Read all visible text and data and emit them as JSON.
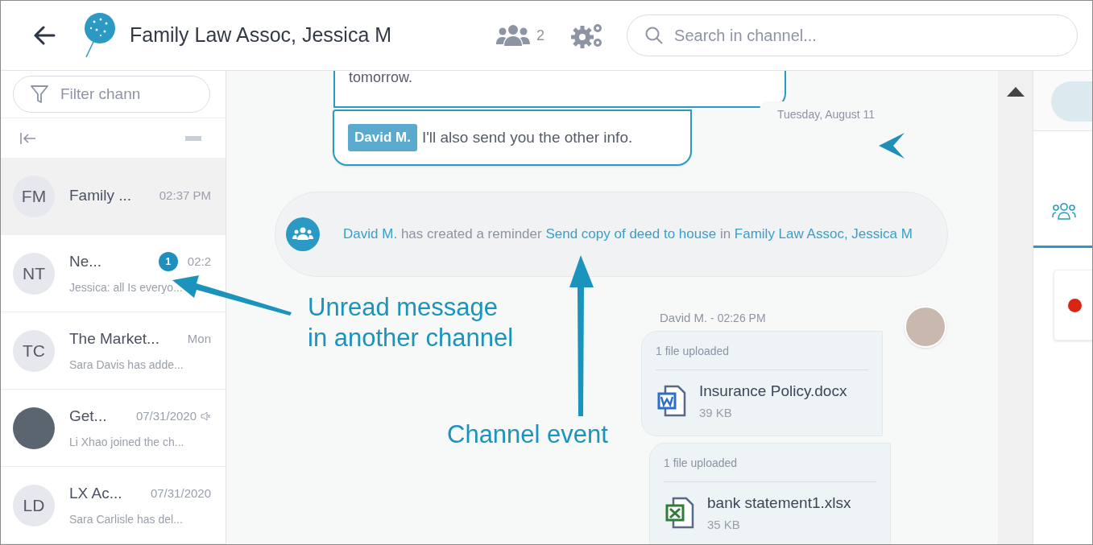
{
  "header": {
    "title": "Family Law Assoc, Jessica M",
    "member_count": "2",
    "search_placeholder": "Search in channel..."
  },
  "sidebar": {
    "filter_placeholder": "Filter chann",
    "channels": [
      {
        "kind": "initials",
        "initials": "FM",
        "name": "Family ...",
        "time": "02:37 PM",
        "muted": false,
        "selected": true
      },
      {
        "kind": "initials",
        "initials": "NT",
        "name": "Ne...",
        "time": "02:2",
        "preview": "Jessica: all Is everyo...",
        "unread": "1",
        "muted": false,
        "selected": false
      },
      {
        "kind": "initials",
        "initials": "TC",
        "name": "The Market...",
        "time": "Mon",
        "preview": "Sara Davis has adde...",
        "muted": false,
        "selected": false
      },
      {
        "kind": "photo",
        "name": "Get...",
        "time": "07/31/2020",
        "preview": "Li Xhao joined the ch...",
        "muted": true,
        "selected": false
      },
      {
        "kind": "initials",
        "initials": "LD",
        "name": "LX Ac...",
        "time": "07/31/2020",
        "preview": "Sara Carlisle has del...",
        "muted": false,
        "selected": false
      }
    ]
  },
  "chat": {
    "messages": [
      {
        "kind": "tail",
        "text": "tomorrow."
      },
      {
        "kind": "tagged",
        "author": "David M.",
        "text": "I'll also send you the other info."
      }
    ],
    "date_separator": "Tuesday, August 11",
    "event": [
      {
        "text": "David M.",
        "link": true
      },
      {
        "text": " has created a reminder ",
        "link": false
      },
      {
        "text": "Send copy of deed to house",
        "link": true
      },
      {
        "text": " in ",
        "link": false
      },
      {
        "text": "Family Law Assoc,",
        "link": true
      },
      {
        "text": "Jessica M",
        "link": true
      }
    ],
    "upload_author": "David M.",
    "upload_time": " - 02:26 PM",
    "uploads": [
      {
        "kind": "word",
        "label": "1 file uploaded",
        "name": "Insurance Policy.docx",
        "size": "39 KB"
      },
      {
        "kind": "excel",
        "label": "1 file uploaded",
        "name": "bank statement1.xlsx",
        "size": "35 KB"
      }
    ]
  },
  "right_panel": {
    "tabs": [
      {
        "kind": "members",
        "selected": true
      }
    ]
  },
  "annotations": [
    {
      "kind": "unread",
      "text": "Unread message in another channel"
    },
    {
      "kind": "event",
      "text": "Channel event"
    }
  ]
}
